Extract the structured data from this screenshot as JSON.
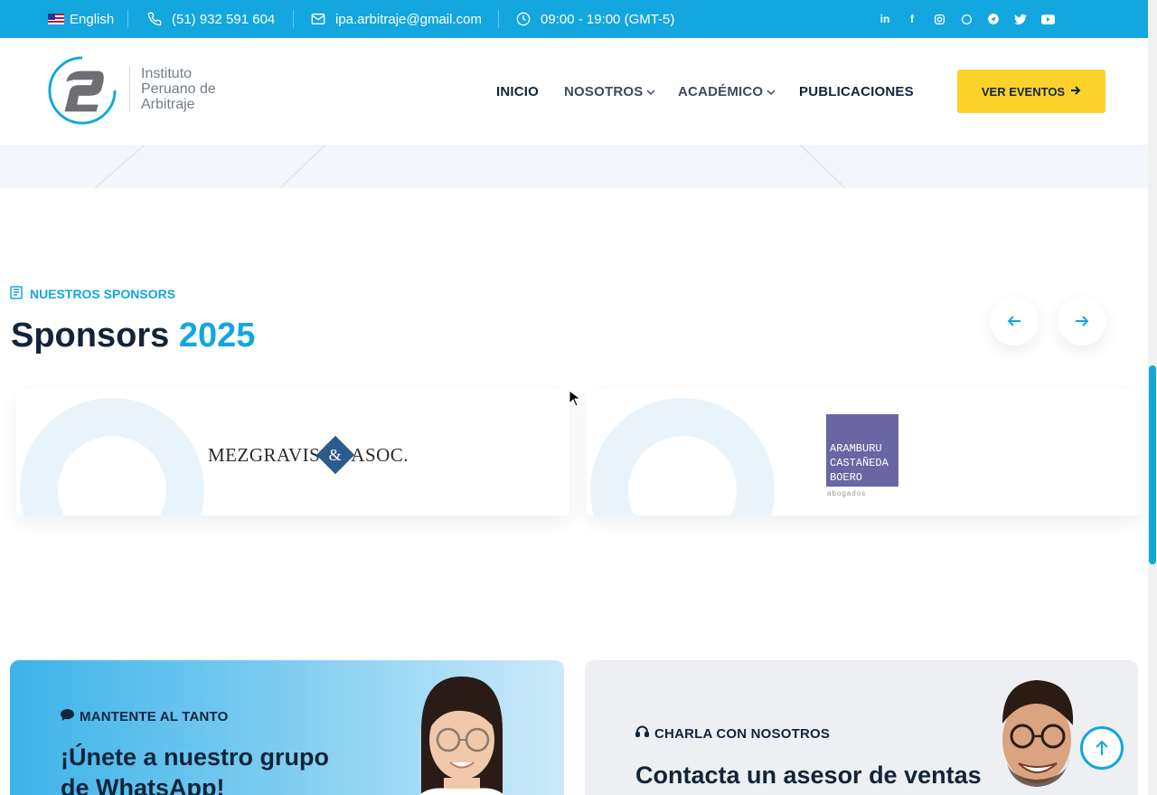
{
  "topbar": {
    "language": "English",
    "phone": "(51) 932 591 604",
    "email": "ipa.arbitraje@gmail.com",
    "hours": "09:00 - 19:00 (GMT-5)",
    "social_icons": [
      "linkedin-icon",
      "facebook-icon",
      "instagram-icon",
      "whatsapp-icon",
      "telegram-icon",
      "twitter-icon",
      "youtube-icon"
    ]
  },
  "header": {
    "logo_line1": "Instituto",
    "logo_line2": "Peruano de",
    "logo_line3": "Arbitraje",
    "nav": {
      "inicio": "INICIO",
      "nosotros": "NOSOTROS",
      "academico": "ACADÉMICO",
      "publicaciones": "PUBLICACIONES"
    },
    "cta_label": "VER EVENTOS"
  },
  "sponsors": {
    "eyebrow": "NUESTROS SPONSORS",
    "title": "Sponsors",
    "title_year": "2025",
    "cards": [
      {
        "name_left": "MEZGRAVIS",
        "amp": "&",
        "name_right": "ASOC."
      },
      {
        "lines": [
          "ARAMBURU",
          "CASTAÑEDA",
          "BOERO"
        ],
        "sub": "abogados"
      }
    ]
  },
  "promos": {
    "whatsapp": {
      "eyebrow": "MANTENTE AL TANTO",
      "title_line1": "¡Únete a nuestro grupo",
      "title_line2": "de WhatsApp!"
    },
    "contact": {
      "eyebrow": "CHARLA CON NOSOTROS",
      "title": "Contacta un asesor de ventas"
    }
  },
  "colors": {
    "brand_blue": "#13a6df",
    "cta_yellow": "#fcd12a",
    "navy": "#13243a"
  }
}
